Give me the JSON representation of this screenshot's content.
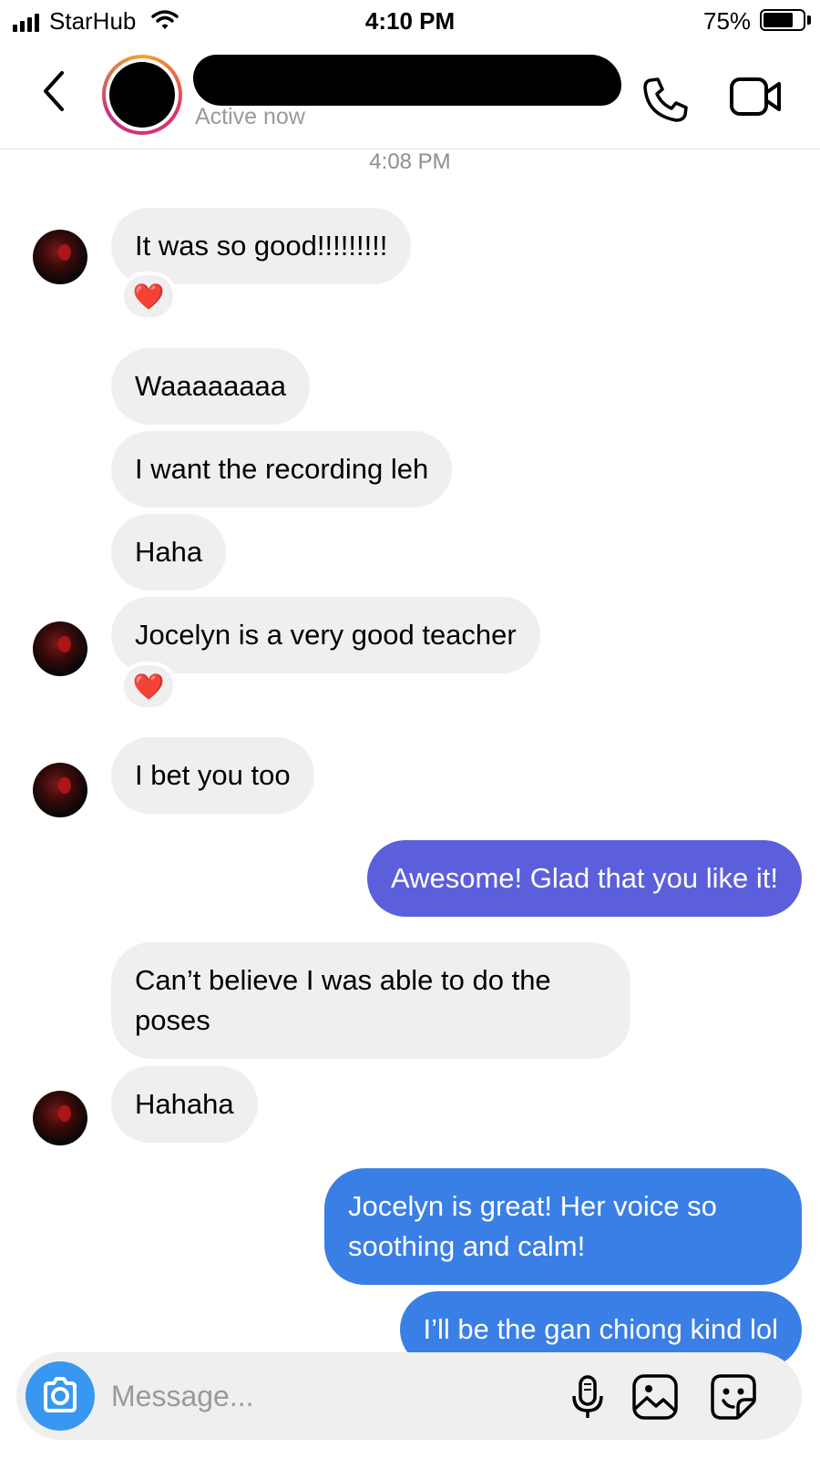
{
  "status_bar": {
    "carrier": "StarHub",
    "time": "4:10 PM",
    "battery_percent": "75%",
    "battery_level": 0.75,
    "signal_icon": "cellular-signal-icon",
    "wifi_icon": "wifi-icon"
  },
  "header": {
    "back_icon": "chevron-left-icon",
    "contact_name_redacted": true,
    "status": "Active now",
    "call_icon": "phone-icon",
    "video_icon": "video-camera-icon"
  },
  "chat": {
    "timestamp": "4:08 PM",
    "incoming_color": "#efefef",
    "reaction_emoji": "❤️",
    "messages": [
      {
        "from": "them",
        "text": "It was so good!!!!!!!!!",
        "reaction": "❤️"
      },
      {
        "from": "them",
        "text": "Waaaaaaaa"
      },
      {
        "from": "them",
        "text": "I want the recording leh"
      },
      {
        "from": "them",
        "text": "Haha"
      },
      {
        "from": "them",
        "text": "Jocelyn is a very good teacher",
        "reaction": "❤️"
      },
      {
        "from": "them",
        "text": "I bet you too"
      },
      {
        "from": "me",
        "text": "Awesome! Glad that you like it!",
        "color": "#5b5fdc"
      },
      {
        "from": "them",
        "text": "Can’t believe I was able to do the poses"
      },
      {
        "from": "them",
        "text": "Hahaha"
      },
      {
        "from": "me",
        "text": "Jocelyn is great! Her voice so soothing and calm!",
        "color": "#3a7fe6"
      },
      {
        "from": "me",
        "text": "I’ll be the gan chiong kind lol",
        "color": "#3a7fe6"
      }
    ]
  },
  "composer": {
    "placeholder": "Message...",
    "camera_icon": "camera-icon",
    "mic_icon": "microphone-icon",
    "gallery_icon": "image-gallery-icon",
    "sticker_icon": "sticker-icon",
    "camera_color": "#3897f0"
  }
}
